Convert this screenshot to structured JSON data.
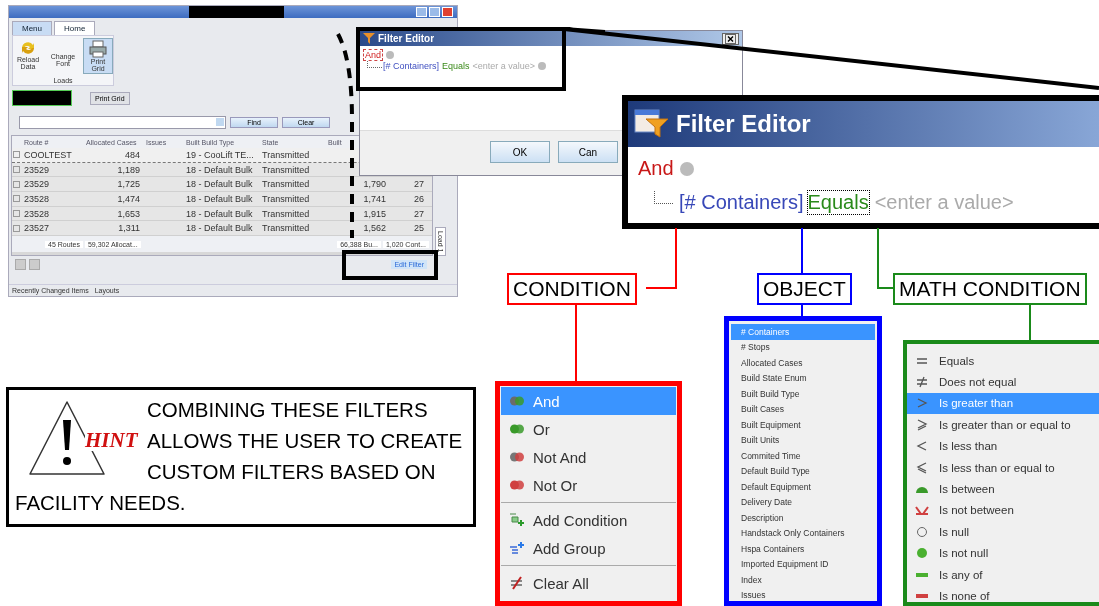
{
  "app": {
    "tabs": [
      {
        "label": "Menu",
        "selected": false
      },
      {
        "label": "Home",
        "selected": true
      }
    ],
    "ribbon": {
      "buttons": [
        {
          "label": "Reload Data",
          "kind": "reload"
        },
        {
          "label": "Change Font",
          "kind": "font"
        },
        {
          "label": "Print Grid",
          "kind": "print"
        }
      ],
      "group": "Loads"
    },
    "print_grid_button": "Print Grid",
    "find_button": "Find",
    "clear_button": "Clear",
    "table": {
      "columns": [
        "Route #",
        "Allocated Cases",
        "Issues",
        "Built Build Type",
        "State",
        "Built"
      ],
      "rows": [
        {
          "cells": [
            "COOLTEST",
            "484",
            null,
            "19 - CooLift TE...",
            "Transmitted",
            null,
            null
          ],
          "selected": true
        },
        {
          "cells": [
            "23529",
            "1,189",
            null,
            "18 - Default Bulk",
            "Transmitted",
            null,
            null
          ],
          "selected": false
        },
        {
          "cells": [
            "23529",
            "1,725",
            null,
            "18 - Default Bulk",
            "Transmitted",
            "1,790",
            "27"
          ],
          "selected": false
        },
        {
          "cells": [
            "23528",
            "1,474",
            null,
            "18 - Default Bulk",
            "Transmitted",
            "1,741",
            "26"
          ],
          "selected": false
        },
        {
          "cells": [
            "23528",
            "1,653",
            null,
            "18 - Default Bulk",
            "Transmitted",
            "1,915",
            "27"
          ],
          "selected": false
        },
        {
          "cells": [
            "23527",
            "1,311",
            null,
            "18 - Default Bulk",
            "Transmitted",
            "1,562",
            "25"
          ],
          "selected": false
        }
      ],
      "summary": [
        "45 Routes",
        "59,302 Allocat...",
        "66,388 Bu...",
        "1,020 Cont..."
      ]
    },
    "side_tab": "Load 1",
    "edit_filter_link": "Edit Filter",
    "status_items": [
      "Recently Changed Items",
      "Layouts"
    ]
  },
  "small_dialog": {
    "title": "Filter Editor",
    "group": "And",
    "field": "[# Containers]",
    "operator": "Equals",
    "value_placeholder": "<enter a value>",
    "buttons": [
      "OK",
      "Can"
    ]
  },
  "zoomed_editor": {
    "title": "Filter Editor",
    "group": "And",
    "field": "[# Containers]",
    "operator": "Equals",
    "value_placeholder": "<enter a value>"
  },
  "labels": {
    "condition": "CONDITION",
    "object": "OBJECT",
    "math_condition": "MATH CONDITION"
  },
  "condition_menu": [
    [
      {
        "label": "And",
        "kind": "and",
        "selected": true
      },
      {
        "label": "Or",
        "kind": "or",
        "selected": false
      },
      {
        "label": "Not And",
        "kind": "not-and",
        "selected": false
      },
      {
        "label": "Not Or",
        "kind": "not-or",
        "selected": false
      }
    ],
    [
      {
        "label": "Add Condition",
        "kind": "add-condition",
        "selected": false
      },
      {
        "label": "Add Group",
        "kind": "add-group",
        "selected": false
      }
    ],
    [
      {
        "label": "Clear All",
        "kind": "clear-all",
        "selected": false
      }
    ]
  ],
  "object_list": [
    {
      "label": "# Containers",
      "selected": true
    },
    {
      "label": "# Stops",
      "selected": false
    },
    {
      "label": "Allocated Cases",
      "selected": false
    },
    {
      "label": "Build State Enum",
      "selected": false
    },
    {
      "label": "Built Build Type",
      "selected": false
    },
    {
      "label": "Built Cases",
      "selected": false
    },
    {
      "label": "Built Equipment",
      "selected": false
    },
    {
      "label": "Built Units",
      "selected": false
    },
    {
      "label": "Commited Time",
      "selected": false
    },
    {
      "label": "Default Build Type",
      "selected": false
    },
    {
      "label": "Default Equipment",
      "selected": false
    },
    {
      "label": "Delivery Date",
      "selected": false
    },
    {
      "label": "Description",
      "selected": false
    },
    {
      "label": "Handstack Only Containers",
      "selected": false
    },
    {
      "label": "Hspa Containers",
      "selected": false
    },
    {
      "label": "Imported Equipment ID",
      "selected": false
    },
    {
      "label": "Index",
      "selected": false
    },
    {
      "label": "Issues",
      "selected": false
    }
  ],
  "math_list": [
    {
      "label": "Equals",
      "kind": "eq",
      "selected": false
    },
    {
      "label": "Does not equal",
      "kind": "neq",
      "selected": false
    },
    {
      "label": "Is greater than",
      "kind": "gt",
      "selected": true
    },
    {
      "label": "Is greater than or equal to",
      "kind": "gte",
      "selected": false
    },
    {
      "label": "Is less than",
      "kind": "lt",
      "selected": false
    },
    {
      "label": "Is less than or equal to",
      "kind": "lte",
      "selected": false
    },
    {
      "label": "Is between",
      "kind": "between",
      "selected": false
    },
    {
      "label": "Is not between",
      "kind": "not-between",
      "selected": false
    },
    {
      "label": "Is null",
      "kind": "null",
      "selected": false
    },
    {
      "label": "Is not null",
      "kind": "not-null",
      "selected": false
    },
    {
      "label": "Is any of",
      "kind": "any-of",
      "selected": false
    },
    {
      "label": "Is none of",
      "kind": "none-of",
      "selected": false
    }
  ],
  "hint": {
    "badge": "HINT",
    "text_lines": [
      "COMBINING THESE FILTERS",
      "ALLOWS THE USER TO CREATE",
      "CUSTOM FILTERS BASED ON",
      "FACILITY NEEDS."
    ]
  }
}
